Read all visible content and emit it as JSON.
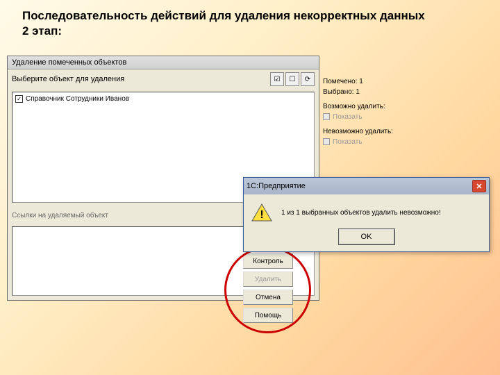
{
  "heading_line1": "Последовательность действий для удаления некорректных данных",
  "heading_line2": "2 этап:",
  "main_window": {
    "title": "Удаление помеченных объектов",
    "select_label": "Выберите объект для удаления",
    "item1": "Справочник Сотрудники Иванов",
    "refs_label": "Ссылки на удаляемый объект"
  },
  "side": {
    "marked": "Помечено: 1",
    "selected": "Выбрано: 1",
    "can_delete": "Возможно удалить:",
    "show1": "Показать",
    "cant_delete": "Невозможно удалить:",
    "show2": "Показать"
  },
  "actions": {
    "control": "Контроль",
    "delete": "Удалить",
    "cancel": "Отмена",
    "help": "Помощь"
  },
  "dialog": {
    "title": "1С:Предприятие",
    "message": "1 из 1 выбранных объектов удалить невозможно!",
    "ok": "OK"
  }
}
